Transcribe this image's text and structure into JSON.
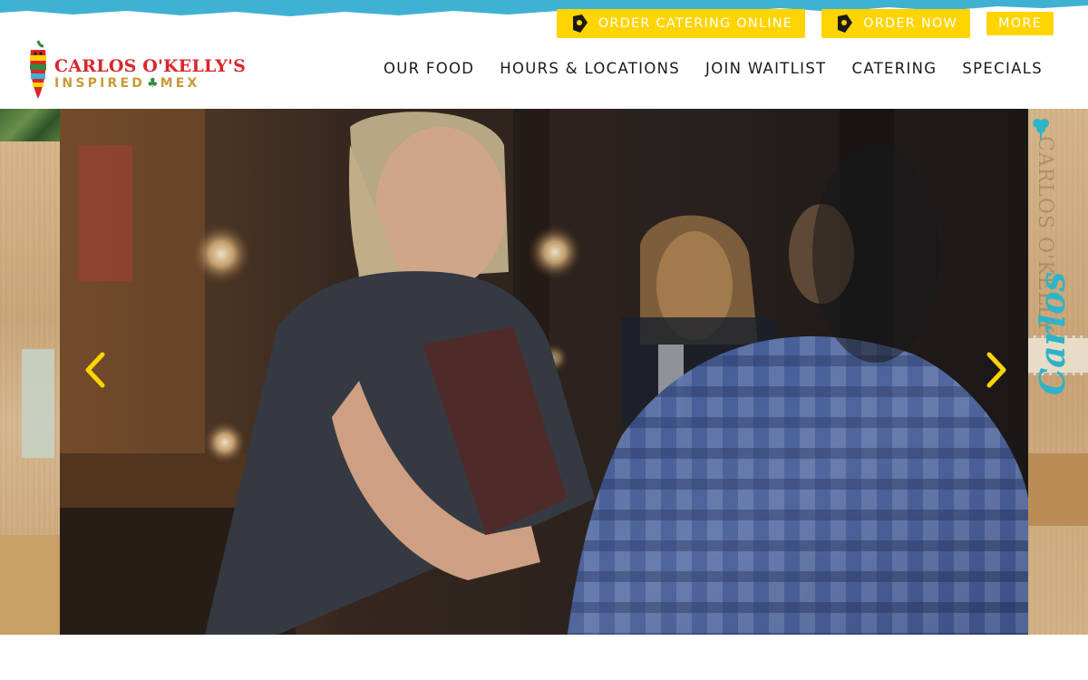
{
  "brand": {
    "name": "CARLOS O'KELLY'S",
    "tagline_left": "INSPIRED",
    "tagline_right": "MEX",
    "colors": {
      "red": "#d9262c",
      "gold": "#c99a37",
      "yellow": "#ffd400",
      "teal": "#2fb3c8"
    }
  },
  "utility_nav": [
    {
      "label": "ORDER CATERING ONLINE",
      "icon": "taco-truck-icon"
    },
    {
      "label": "ORDER NOW",
      "icon": "taco-truck-icon"
    },
    {
      "label": "MORE",
      "icon": ""
    }
  ],
  "main_nav": [
    {
      "label": "OUR FOOD"
    },
    {
      "label": "HOURS & LOCATIONS"
    },
    {
      "label": "JOIN WAITLIST"
    },
    {
      "label": "CATERING"
    },
    {
      "label": "SPECIALS"
    }
  ],
  "hero": {
    "prev_icon": "chevron-left-icon",
    "next_icon": "chevron-right-icon"
  },
  "side_panels": {
    "right_vertical_text": "CARLOS O'KELLY'S",
    "right_script": "Carlos"
  }
}
